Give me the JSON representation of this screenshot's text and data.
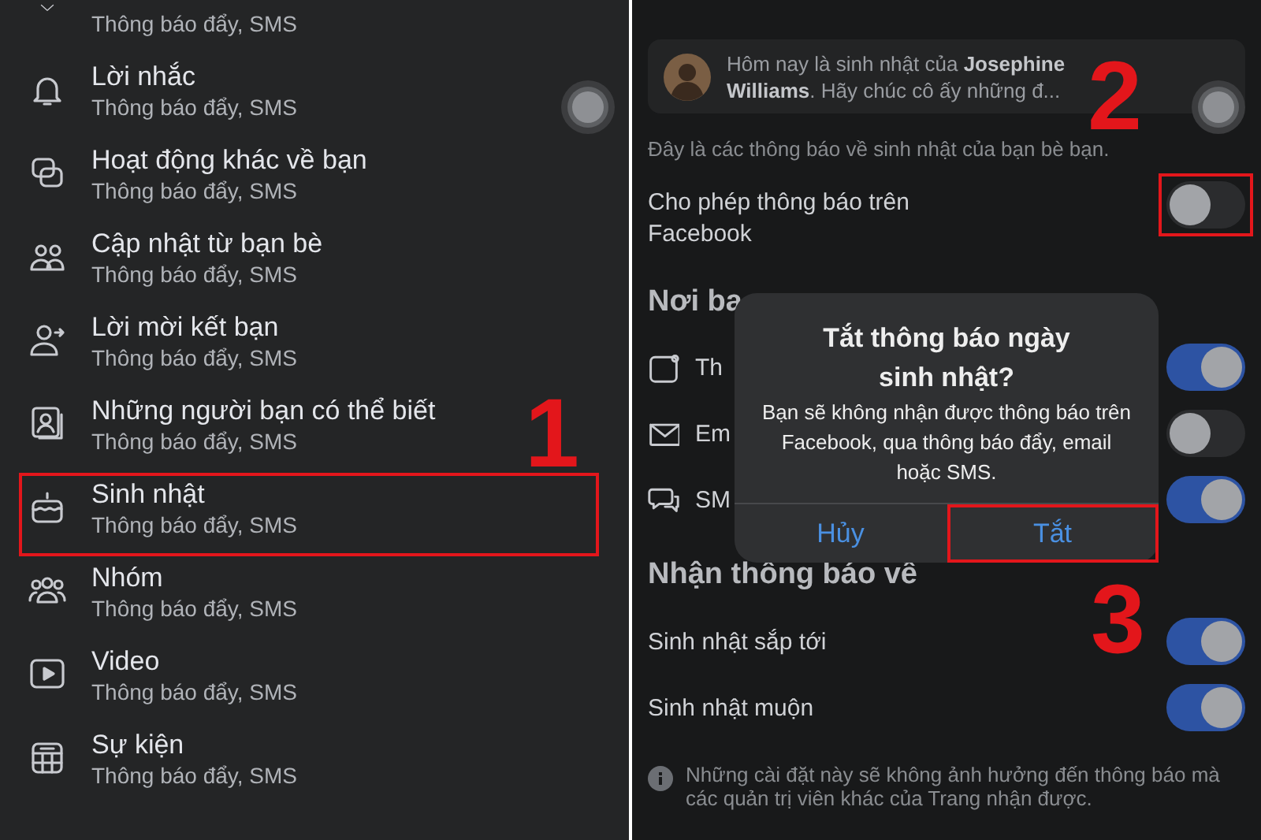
{
  "notification_types": [
    {
      "subtitle": "Thông báo đẩy, SMS",
      "highlighted": false
    },
    {
      "title": "Lời nhắc",
      "subtitle": "Thông báo đẩy, SMS",
      "highlighted": false
    },
    {
      "title": "Hoạt động khác về bạn",
      "subtitle": "Thông báo đẩy, SMS",
      "highlighted": false
    },
    {
      "title": "Cập nhật từ bạn bè",
      "subtitle": "Thông báo đẩy, SMS",
      "highlighted": false
    },
    {
      "title": "Lời mời kết bạn",
      "subtitle": "Thông báo đẩy, SMS",
      "highlighted": false
    },
    {
      "title": "Những người bạn có thể biết",
      "subtitle": "Thông báo đẩy, SMS",
      "highlighted": false
    },
    {
      "title": "Sinh nhật",
      "subtitle": "Thông báo đẩy, SMS",
      "highlighted": true
    },
    {
      "title": "Nhóm",
      "subtitle": "Thông báo đẩy, SMS",
      "highlighted": false
    },
    {
      "title": "Video",
      "subtitle": "Thông báo đẩy, SMS",
      "highlighted": false
    },
    {
      "title": "Sự kiện",
      "subtitle": "Thông báo đẩy, SMS",
      "highlighted": false
    }
  ],
  "birthday_settings": {
    "preview": "Hôm nay là sinh nhật của **Josephine Williams**. Hãy chúc cô ấy những đ...",
    "description": "Đây là các thông báo về sinh nhật của bạn bè bạn.",
    "allow": {
      "label": "Cho phép thông báo trên Facebook",
      "on": false,
      "highlighted": true
    },
    "channels_heading": "Nơi ba",
    "channels": [
      {
        "label": "Th",
        "on": true
      },
      {
        "label": "Em",
        "on": false
      },
      {
        "label": "SM",
        "on": true
      }
    ],
    "receive_heading": "Nhận thông báo về",
    "receive_options": [
      {
        "label": "Sinh nhật sắp tới",
        "on": true
      },
      {
        "label": "Sinh nhật muộn",
        "on": true
      }
    ],
    "note": "Những cài đặt này sẽ không ảnh hưởng đến thông báo mà các quản trị viên khác của Trang nhận được."
  },
  "dialog": {
    "title": "Tắt thông báo ngày sinh nhật?",
    "message": "Bạn sẽ không nhận được thông báo trên Facebook, qua thông báo đẩy, email hoặc SMS.",
    "buttons": [
      {
        "label": "Hủy",
        "highlighted": false
      },
      {
        "label": "Tắt",
        "highlighted": true
      }
    ]
  },
  "annotations": [
    {
      "label": "1"
    },
    {
      "label": "2"
    },
    {
      "label": "3"
    }
  ]
}
